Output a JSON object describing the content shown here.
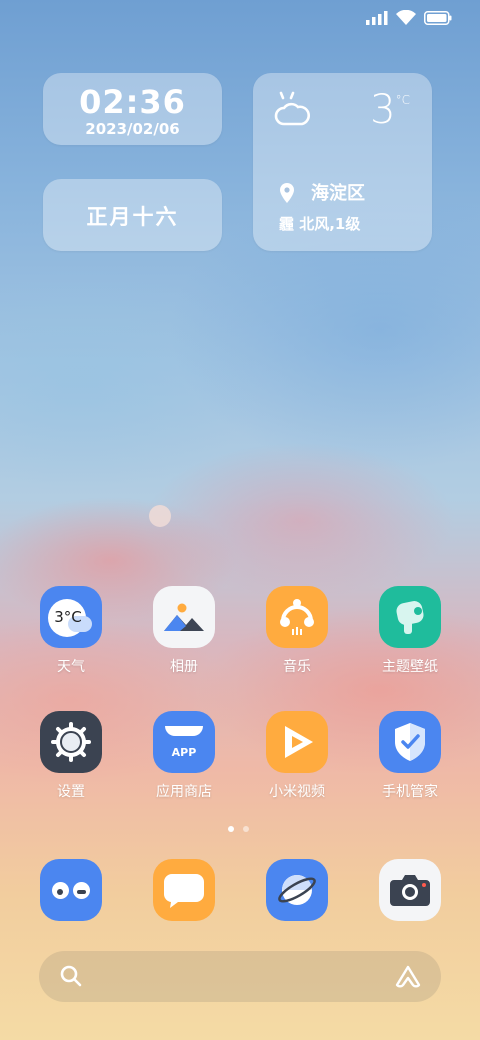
{
  "status_bar": {
    "icons": [
      "signal-icon",
      "wifi-icon",
      "battery-icon"
    ]
  },
  "clock_widget": {
    "time": "02:36",
    "date": "2023/02/06"
  },
  "lunar_widget": {
    "text": "正月十六"
  },
  "weather_widget": {
    "icon": "cloudy-icon",
    "temperature": "3",
    "unit": "°C",
    "location": "海淀区",
    "condition": "霾 北风,1级"
  },
  "apps": [
    {
      "label": "天气",
      "icon": "weather-app-icon",
      "icon_text": "3°C",
      "color": "#4b86f0"
    },
    {
      "label": "相册",
      "icon": "gallery-icon",
      "color": "#f4f5f7"
    },
    {
      "label": "音乐",
      "icon": "music-icon",
      "color": "#ffab3f"
    },
    {
      "label": "主题壁纸",
      "icon": "themes-icon",
      "color": "#1fbc9c"
    },
    {
      "label": "设置",
      "icon": "settings-icon",
      "color": "#3b4351"
    },
    {
      "label": "应用商店",
      "icon": "app-store-icon",
      "icon_text": "APP",
      "color": "#4b86f0"
    },
    {
      "label": "小米视频",
      "icon": "video-icon",
      "color": "#ffab3f"
    },
    {
      "label": "手机管家",
      "icon": "security-icon",
      "color": "#4b86f0"
    }
  ],
  "page_indicator": {
    "count": 2,
    "active": 0
  },
  "dock": [
    {
      "icon": "phone-icon",
      "color": "#4b86f0"
    },
    {
      "icon": "messages-icon",
      "color": "#ffab3f"
    },
    {
      "icon": "browser-icon",
      "color": "#4b86f0"
    },
    {
      "icon": "camera-icon",
      "color": "#f4f5f7"
    }
  ],
  "search_bar": {
    "left_icon": "search-icon",
    "right_icon": "assistant-icon"
  }
}
